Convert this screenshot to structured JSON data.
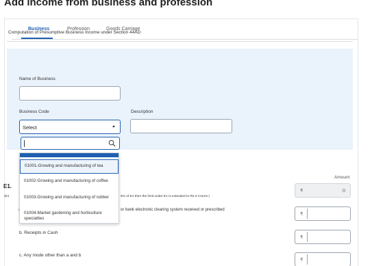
{
  "page": {
    "title": "Add income from business and profession"
  },
  "tabs": [
    {
      "label": "Business",
      "active": true
    },
    {
      "label": "Profession",
      "active": false
    },
    {
      "label": "Goods Carriage",
      "active": false
    }
  ],
  "section": {
    "heading": "Computation of Presumptive Business Income under Section 44AD"
  },
  "form": {
    "name_of_business_label": "Name of Business",
    "name_of_business_value": "",
    "business_code_label": "Business Code",
    "business_code_selected": "Select",
    "description_label": "Description",
    "description_value": "",
    "search_value": ""
  },
  "dropdown": {
    "options": [
      "01001-Growing and manufacturing of tea",
      "01002-Growing and manufacturing of coffee",
      "01003-Growing and manufacturing of rubber",
      "01004-Market gardening and horticulture specialties"
    ],
    "selected_index": 0
  },
  "income": {
    "amount_header": "Amount",
    "e1_label": "E1.",
    "e1_sub": "(E1",
    "e1_note": "5% of E1 then the limit under E1 is extended to Rs.3 Crores.)",
    "a_prefix": "a",
    "a_partial": "or bank electronic clearing system received or prescribed",
    "b_label": "b. Receipts in Cash",
    "c_label": "c. Any mode other than a and b",
    "currency_symbol": "₹",
    "e1_value": "0"
  },
  "colors": {
    "accent": "#1f5fb0",
    "panel": "#eaf2fb"
  }
}
